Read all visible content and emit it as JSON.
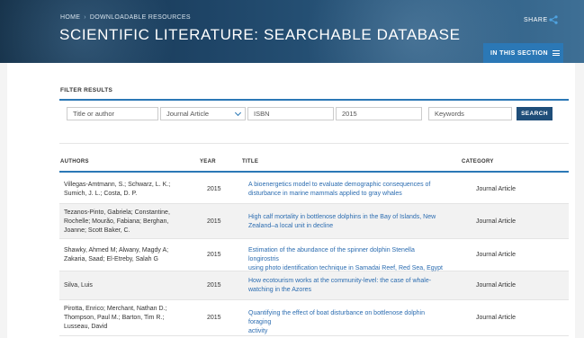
{
  "header": {
    "breadcrumb": [
      "HOME",
      "DOWNLOADABLE RESOURCES"
    ],
    "breadcrumb_sep": "›",
    "title": "SCIENTIFIC LITERATURE: SEARCHABLE DATABASE",
    "share_label": "SHARE",
    "section_button_label": "IN THIS SECTION"
  },
  "filter": {
    "label": "FILTER RESULTS",
    "title_author_placeholder": "Title or author",
    "type_selected": "Journal Article",
    "isbn_placeholder": "ISBN",
    "year_value": "2015",
    "keywords_placeholder": "Keywords",
    "search_label": "SEARCH"
  },
  "table": {
    "headers": {
      "authors": "AUTHORS",
      "year": "YEAR",
      "title": "TITLE",
      "category": "CATEGORY"
    },
    "rows": [
      {
        "authors": [
          "Villegas-Amtmann, S.; Schwarz, L. K.;",
          "Sumich, J. L.; Costa, D. P."
        ],
        "year": "2015",
        "title": [
          "A bioenergetics model to evaluate demographic consequences of",
          "disturbance in marine mammals applied to gray whales"
        ],
        "category": "Journal Article"
      },
      {
        "authors": [
          "Tezanos-Pinto, Gabriela; Constantine,",
          "Rochelle; Mourão, Fabiana; Berghan,",
          "Joanne; Scott Baker, C."
        ],
        "year": "2015",
        "title": [
          "High calf mortality in bottlenose dolphins in the Bay of Islands, New",
          "Zealand–a local unit in decline"
        ],
        "category": "Journal Article"
      },
      {
        "authors": [
          "Shawky, Ahmed M; Alwany, Magdy A;",
          "Zakaria, Saad; El-Etreby, Salah G"
        ],
        "year": "2015",
        "title": [
          "Estimation of the abundance of the spinner dolphin Stenella longirostris",
          "using photo identification technique in Samadai Reef, Red Sea, Egypt"
        ],
        "category": "Journal Article"
      },
      {
        "authors": [
          "Silva, Luis"
        ],
        "year": "2015",
        "title": [
          "How ecotourism works at the community-level: the case of whale-",
          "watching in the Azores"
        ],
        "category": "Journal Article"
      },
      {
        "authors": [
          "Pirotta, Enrico; Merchant, Nathan D.;",
          "Thompson, Paul M.; Barton, Tim R.;",
          "Lusseau, David"
        ],
        "year": "2015",
        "title": [
          "Quantifying the effect of boat disturbance on bottlenose dolphin foraging",
          "activity"
        ],
        "category": "Journal Article"
      }
    ]
  },
  "colors": {
    "accent": "#2b78b6",
    "link": "#2b6cb0",
    "search_button": "#1f4e79"
  }
}
